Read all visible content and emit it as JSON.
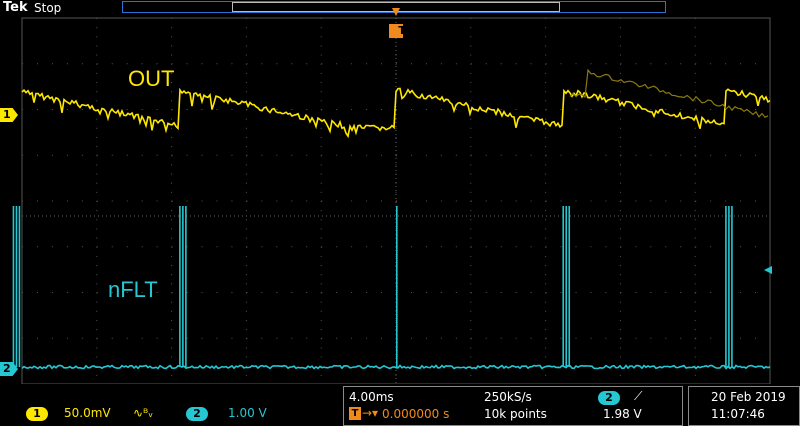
{
  "header": {
    "brand": "Tek",
    "acq_state": "Stop"
  },
  "trigger": {
    "marker_label": "T"
  },
  "channels": [
    {
      "number": "1",
      "name": "OUT",
      "color": "#ffe800",
      "scale": "50.0mV",
      "coupling_icon": "bandwidth-limit-icon",
      "coupling_glyph": "∿ᴮᵥ"
    },
    {
      "number": "2",
      "name": "nFLT",
      "color": "#25c8d2",
      "scale": "1.00 V"
    }
  ],
  "timebase": {
    "time_per_div": "4.00ms",
    "sample_rate": "250kS/s",
    "trigger_delay": "0.000000 s",
    "record_length": "10k points"
  },
  "trigger_readout": {
    "source": "2",
    "slope_icon": "rising-edge-icon",
    "slope_glyph": "⟋",
    "level": "1.98 V"
  },
  "datetime": {
    "date": "20 Feb  2019",
    "time": "11:07:46"
  },
  "waveform_events": {
    "burst_times_ms": [
      -20.5,
      -11.6,
      0.0,
      8.9,
      17.6
    ]
  }
}
